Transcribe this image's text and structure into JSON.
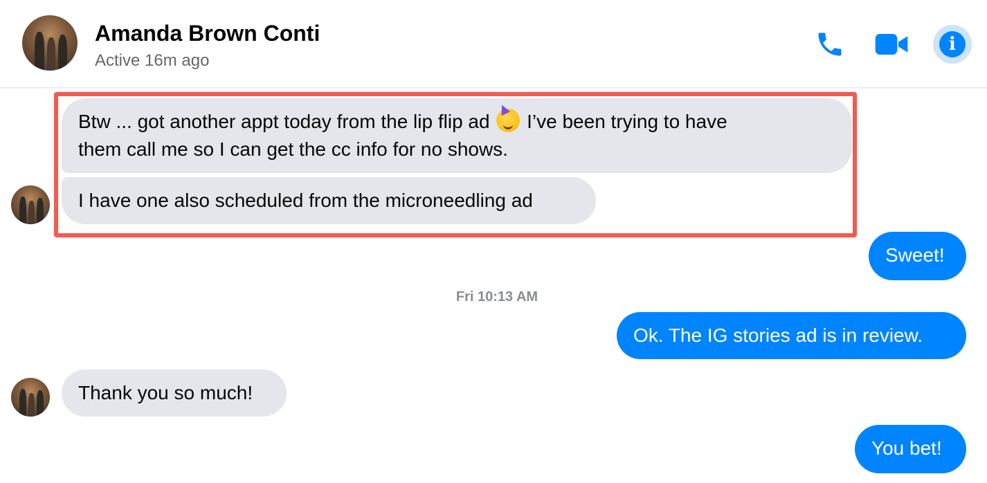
{
  "header": {
    "contact_name": "Amanda Brown Conti",
    "status": "Active 16m ago",
    "icons": [
      "phone-icon",
      "video-camera-icon",
      "info-icon"
    ],
    "info_glyph": "i",
    "accent_color": "#0084ff"
  },
  "messages": [
    {
      "side": "incoming",
      "text_before_emoji": "Btw ... got another appt today from the lip flip ad",
      "emoji": "partying-face-emoji",
      "text_after_emoji": "I’ve been trying to have",
      "line2": "them call me so I can get the cc info for no shows."
    },
    {
      "side": "incoming",
      "text": "I have one also scheduled from the microneedling ad"
    },
    {
      "side": "outgoing",
      "text": "Sweet!"
    },
    {
      "side": "timestamp",
      "text": "Fri 10:13 AM"
    },
    {
      "side": "outgoing",
      "text": "Ok. The IG stories ad is in review."
    },
    {
      "side": "incoming",
      "text": "Thank you so much!"
    },
    {
      "side": "outgoing",
      "text": "You bet!"
    }
  ],
  "highlight_color": "#f25c4f"
}
